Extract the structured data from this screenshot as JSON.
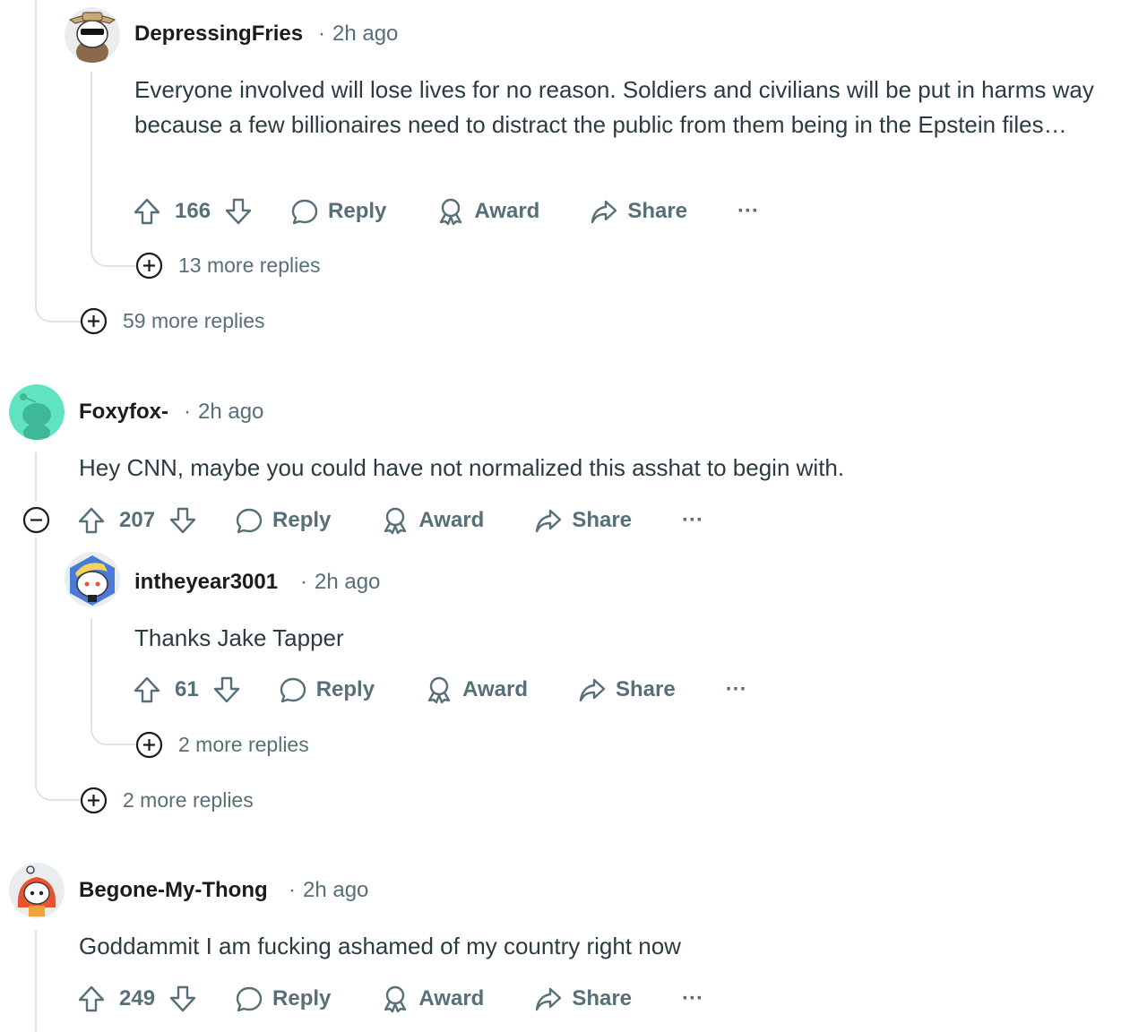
{
  "comments": [
    {
      "username": "DepressingFries",
      "timestamp": "2h ago",
      "body": "Everyone involved will lose lives for no reason. Soldiers and civilians will be put in harms way because a few billionaires need to distract the public from them being in the Epstein files…",
      "votes": "166",
      "more_replies": "13 more replies"
    },
    {
      "username": "Foxyfox-",
      "timestamp": "2h ago",
      "body": "Hey CNN, maybe you could have not normalized this asshat to begin with.",
      "votes": "207"
    },
    {
      "username": "intheyear3001",
      "timestamp": "2h ago",
      "body": "Thanks Jake Tapper",
      "votes": "61",
      "more_replies": "2 more replies"
    },
    {
      "username": "Begone-My-Thong",
      "timestamp": "2h ago",
      "body": "Goddammit I am fucking ashamed of my country right now",
      "votes": "249"
    }
  ],
  "thread_more_replies": {
    "first": "59 more replies",
    "second": "2 more replies"
  },
  "actions": {
    "reply": "Reply",
    "award": "Award",
    "share": "Share",
    "overflow": "···"
  },
  "colors": {
    "meta_text": "#576f76",
    "body_text": "#2a3c42",
    "thread_line": "#e0e3e5",
    "avatar_foxy": "#5fe3c0"
  }
}
